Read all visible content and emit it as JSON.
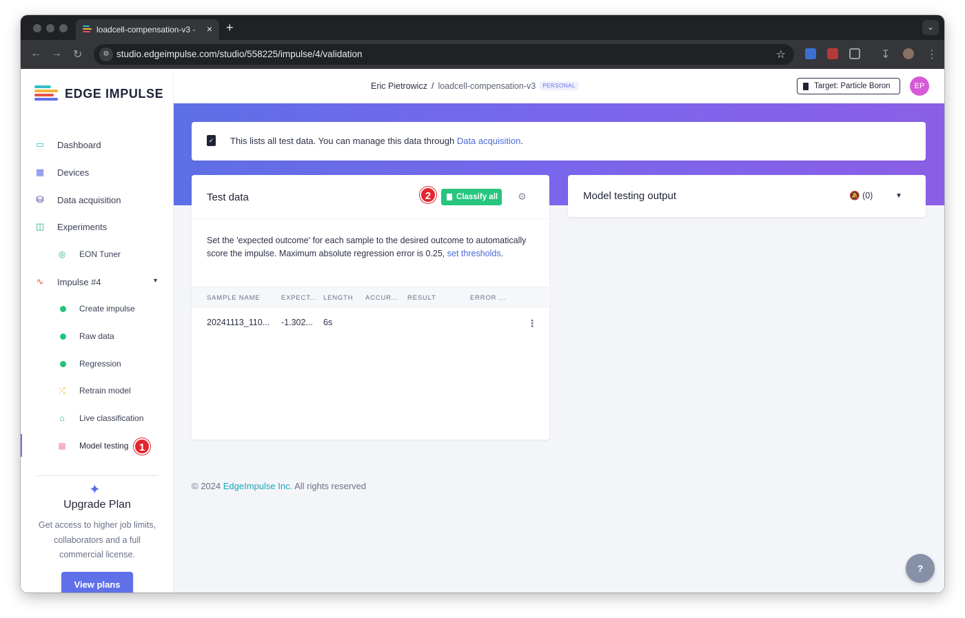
{
  "browser": {
    "tab_title": "loadcell-compensation-v3 - ",
    "url": "studio.edgeimpulse.com/studio/558225/impulse/4/validation",
    "new_tab": "+",
    "close": "×"
  },
  "brand": {
    "name": "EDGE IMPULSE",
    "logo_colors": [
      "#2ec0c6",
      "#f3b53b",
      "#e9534b",
      "#5f70e8"
    ]
  },
  "sidebar": {
    "items": [
      {
        "label": "Dashboard",
        "icon": "monitor-icon"
      },
      {
        "label": "Devices",
        "icon": "chip-icon"
      },
      {
        "label": "Data acquisition",
        "icon": "database-icon"
      },
      {
        "label": "Experiments",
        "icon": "table-icon"
      },
      {
        "label": "EON Tuner",
        "icon": "compass-icon"
      },
      {
        "label": "Impulse #4",
        "icon": "pulse-icon"
      },
      {
        "label": "Create impulse",
        "icon": "status-dot"
      },
      {
        "label": "Raw data",
        "icon": "status-dot"
      },
      {
        "label": "Regression",
        "icon": "status-dot"
      },
      {
        "label": "Retrain model",
        "icon": "shuffle-icon"
      },
      {
        "label": "Live classification",
        "icon": "antenna-icon"
      },
      {
        "label": "Model testing",
        "icon": "clipboard-check-icon"
      }
    ],
    "upgrade": {
      "title": "Upgrade Plan",
      "description": "Get access to higher job limits, collaborators and a full commercial license.",
      "button": "View plans"
    }
  },
  "annotations": {
    "step1": "1",
    "step2": "2"
  },
  "header": {
    "user": "Eric Pietrowicz",
    "separator": "/",
    "project": "loadcell-compensation-v3",
    "project_tag": "PERSONAL",
    "target": "Target: Particle Boron",
    "avatar": "EP"
  },
  "info_banner": {
    "text": "This lists all test data. You can manage this data through ",
    "link": "Data acquisition",
    "suffix": "."
  },
  "test_data": {
    "title": "Test data",
    "classify_button": "Classify all",
    "description": "Set the 'expected outcome' for each sample to the desired outcome to automatically score the impulse. Maximum absolute regression error is 0.25, ",
    "description_link": "set thresholds",
    "description_suffix": ".",
    "columns": [
      "SAMPLE NAME",
      "EXPECT...",
      "LENGTH",
      "ACCUR...",
      "RESULT",
      "ERROR ..."
    ],
    "rows": [
      {
        "sample_name": "20241113_110...",
        "expected": "-1.302...",
        "length": "6s",
        "accuracy": "",
        "result": "",
        "error": ""
      }
    ]
  },
  "model_testing_output": {
    "title": "Model testing output",
    "notification_count": "(0)"
  },
  "footer": {
    "copyright": "© 2024 ",
    "company": "EdgeImpulse Inc.",
    "rights": " All rights reserved"
  },
  "help": "?",
  "colors": {
    "accent": "#5f70e8",
    "success": "#27c67e",
    "hero_gradient_start": "#5e6fe6",
    "hero_gradient_end": "#8b5fe6",
    "annotation_red": "#e4252e",
    "link": "#4a67d6"
  }
}
